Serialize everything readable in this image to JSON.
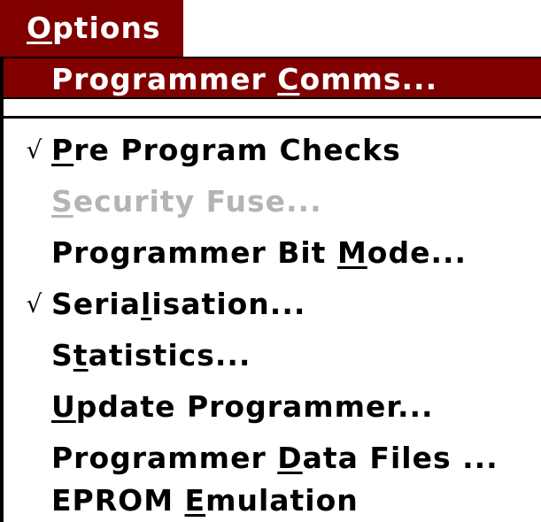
{
  "menu": {
    "title_prefix": "",
    "title_mnemonic": "O",
    "title_suffix": "ptions",
    "items": [
      {
        "prefix": "Programmer ",
        "mnemonic": "C",
        "suffix": "omms...",
        "checked": false,
        "disabled": false,
        "selected": true
      },
      {
        "prefix": "",
        "mnemonic": "P",
        "suffix": "re Program Checks",
        "checked": true,
        "disabled": false,
        "selected": false
      },
      {
        "prefix": "",
        "mnemonic": "S",
        "suffix": "ecurity Fuse...",
        "checked": false,
        "disabled": true,
        "selected": false
      },
      {
        "prefix": "Programmer Bit ",
        "mnemonic": "M",
        "suffix": "ode...",
        "checked": false,
        "disabled": false,
        "selected": false
      },
      {
        "prefix": "Seria",
        "mnemonic": "l",
        "suffix": "isation...",
        "checked": true,
        "disabled": false,
        "selected": false
      },
      {
        "prefix": "S",
        "mnemonic": "t",
        "suffix": "atistics...",
        "checked": false,
        "disabled": false,
        "selected": false
      },
      {
        "prefix": "",
        "mnemonic": "U",
        "suffix": "pdate Programmer...",
        "checked": false,
        "disabled": false,
        "selected": false
      },
      {
        "prefix": "Programmer ",
        "mnemonic": "D",
        "suffix": "ata Files ...",
        "checked": false,
        "disabled": false,
        "selected": false
      },
      {
        "prefix": "EPROM ",
        "mnemonic": "E",
        "suffix": "mulation",
        "checked": false,
        "disabled": false,
        "selected": false
      }
    ],
    "check_glyph": "√"
  },
  "colors": {
    "highlight": "#800000",
    "highlight_text": "#ffffff",
    "disabled_text": "#b4b4b4",
    "text": "#000000"
  }
}
